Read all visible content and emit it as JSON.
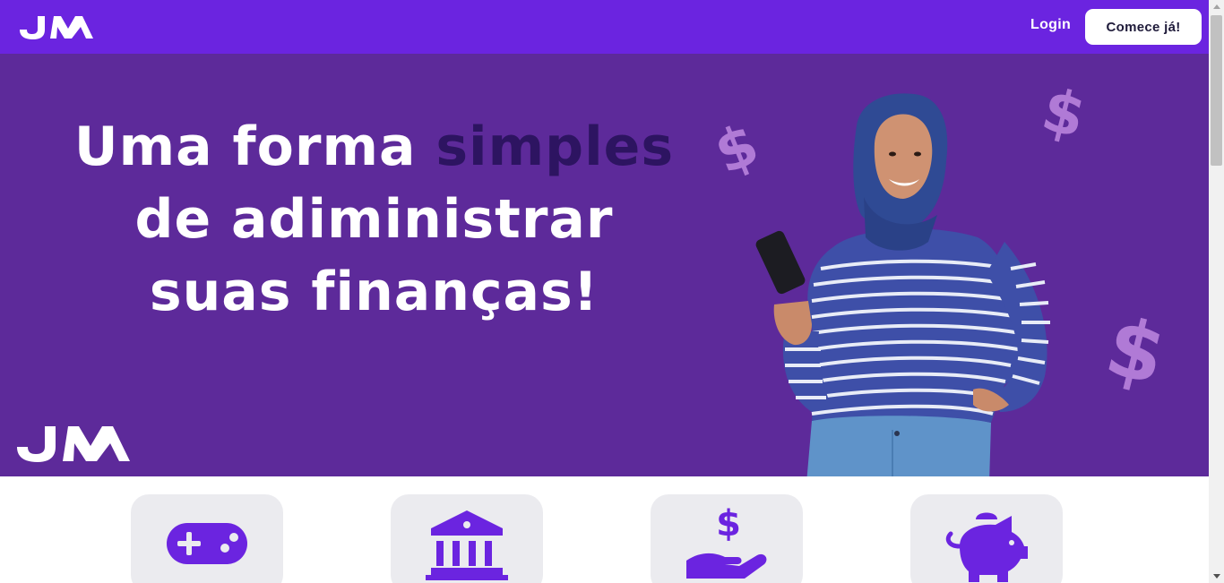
{
  "colors": {
    "header_bg": "#6b24e0",
    "hero_bg": "#5d2a9a",
    "accent_text": "#2d1461",
    "dollar_sign": "#b07ad6",
    "icon": "#6b24e0",
    "card_bg": "#ebebef"
  },
  "header": {
    "logo": "JM",
    "login_label": "Login",
    "start_label": "Comece já!"
  },
  "hero": {
    "headline_part1": "Uma forma ",
    "headline_accent": "simples",
    "headline_line2": "de adiministrar",
    "headline_line3": "suas finanças!",
    "logo": "JM",
    "dollar_symbol": "$"
  },
  "features": [
    {
      "icon": "gamepad-icon"
    },
    {
      "icon": "bank-icon"
    },
    {
      "icon": "hand-money-icon"
    },
    {
      "icon": "piggy-bank-icon"
    }
  ]
}
